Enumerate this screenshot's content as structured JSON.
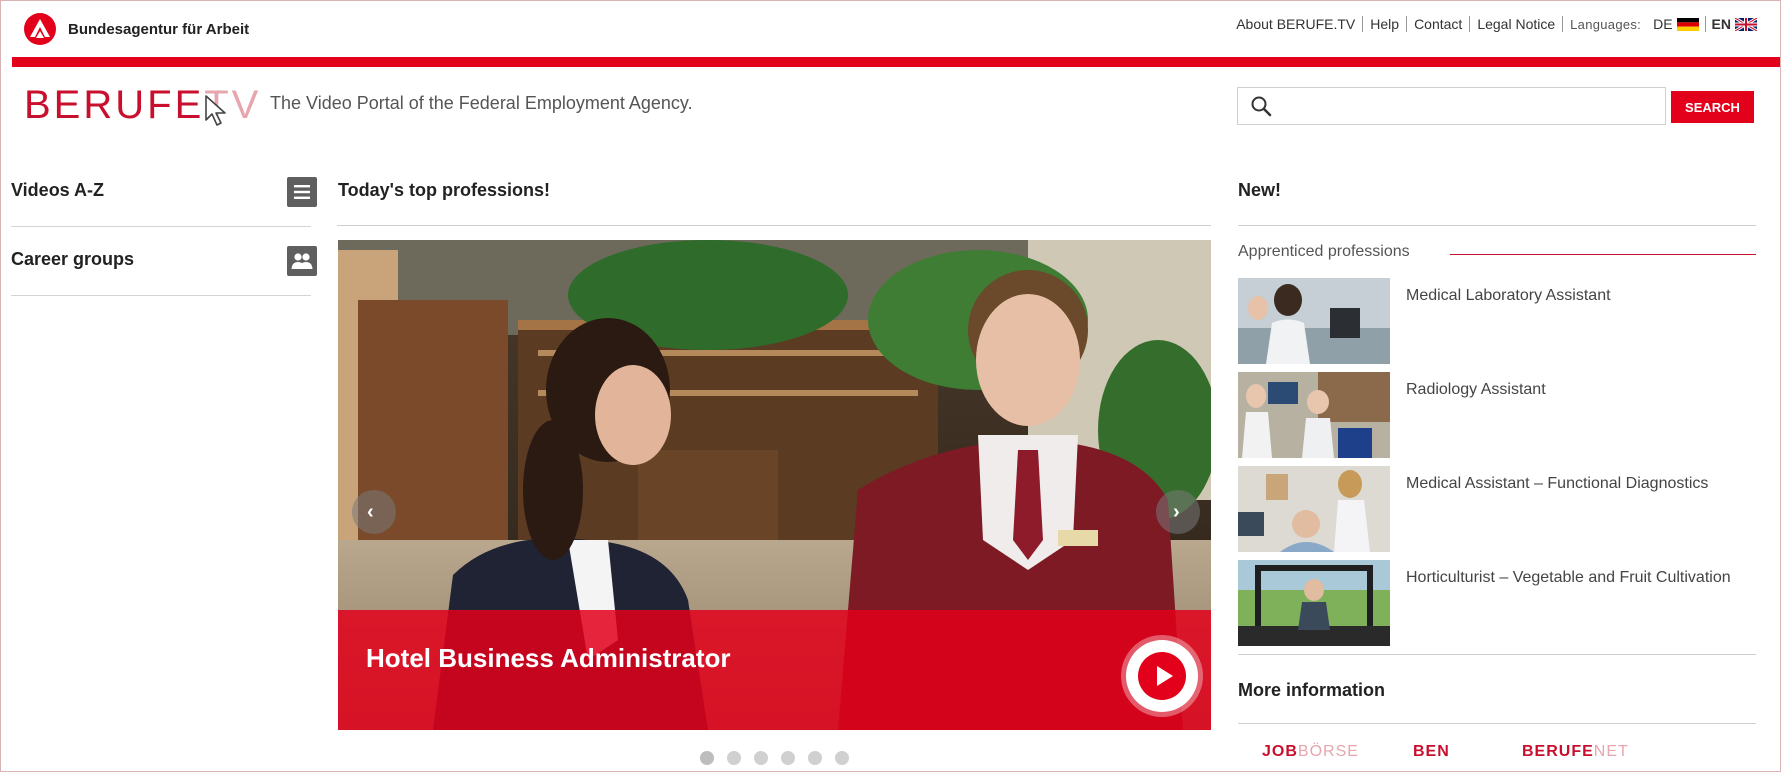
{
  "header": {
    "agency_name": "Bundesagentur für Arbeit",
    "links": [
      "About BERUFE.TV",
      "Help",
      "Contact",
      "Legal Notice"
    ],
    "languages_label": "Languages:",
    "lang_de": "DE",
    "lang_en": "EN"
  },
  "brand": {
    "logo_main": "BERUFE",
    "logo_tv": "TV",
    "tagline": "The Video Portal of the Federal Employment Agency."
  },
  "search": {
    "placeholder": "",
    "value": "",
    "button_label": "SEARCH"
  },
  "sidebar": {
    "items": [
      {
        "label": "Videos A-Z",
        "icon": "list-icon"
      },
      {
        "label": "Career groups",
        "icon": "people-icon"
      }
    ]
  },
  "main": {
    "title": "Today's top professions!",
    "slide_caption": "Hotel Business Administrator",
    "slide_count": 6,
    "active_slide": 0
  },
  "right": {
    "title": "New!",
    "section_label": "Apprenticed professions",
    "professions": [
      "Medical Laboratory Assistant",
      "Radiology Assistant",
      "Medical Assistant – Functional Diagnostics",
      "Horticulturist – Vegetable and Fruit Cultivation"
    ],
    "more_title": "More information",
    "portals": [
      {
        "a": "JOB",
        "b": "BÖRSE"
      },
      {
        "a": "BEN",
        "b": ""
      },
      {
        "a": "BERUFE",
        "b": "NET"
      }
    ]
  },
  "colors": {
    "brand_red": "#e3001b",
    "logo_red": "#c8102e"
  }
}
